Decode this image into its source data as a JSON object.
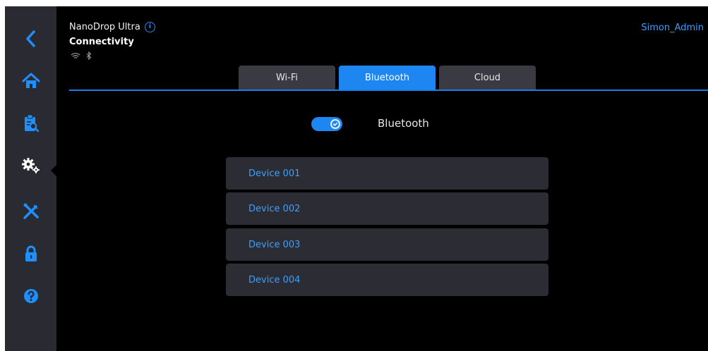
{
  "header": {
    "app_name": "NanoDrop Ultra",
    "page_title": "Connectivity",
    "user": "Simon_Admin"
  },
  "sidebar": {
    "items": [
      {
        "icon": "back-arrow-icon"
      },
      {
        "icon": "home-icon"
      },
      {
        "icon": "clipboard-search-icon"
      },
      {
        "icon": "settings-gears-icon",
        "active": true
      },
      {
        "icon": "tools-icon"
      },
      {
        "icon": "lock-icon"
      },
      {
        "icon": "help-icon"
      }
    ]
  },
  "tabs": [
    {
      "label": "Wi-Fi",
      "active": false
    },
    {
      "label": "Bluetooth",
      "active": true
    },
    {
      "label": "Cloud",
      "active": false
    }
  ],
  "bluetooth": {
    "label": "Bluetooth",
    "enabled": true
  },
  "devices": [
    {
      "name": "Device 001"
    },
    {
      "name": "Device 002"
    },
    {
      "name": "Device 003"
    },
    {
      "name": "Device 004"
    }
  ],
  "colors": {
    "accent": "#1d86f0",
    "link": "#3aa0ff",
    "sidebar": "#2a2a32",
    "panel": "#2c2c34",
    "background": "#000000"
  }
}
